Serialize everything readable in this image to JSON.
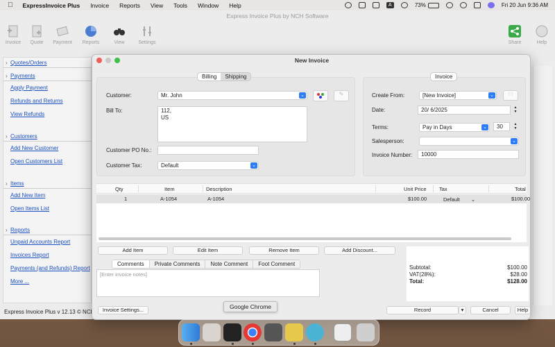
{
  "menubar": {
    "app_name": "ExpressInvoice Plus",
    "menus": [
      "Invoice",
      "Reports",
      "View",
      "Tools",
      "Window",
      "Help"
    ],
    "battery": "73%",
    "clock": "Fri 20 Jun  9:36 AM",
    "input_letter": "A"
  },
  "window": {
    "title": "Express Invoice Plus by NCH Software",
    "status": "Express Invoice Plus v 12.13 © NCH"
  },
  "toolbar": {
    "invoice": "Invoice",
    "quote": "Quote",
    "payment": "Payment",
    "reports": "Reports",
    "view": "View",
    "settings": "Settings",
    "share": "Share",
    "help": "Help"
  },
  "sidebar": {
    "quotes_head": "Quotes/Orders",
    "payments_head": "Payments",
    "payments_links": [
      "Apply Payment",
      "Refunds and Returns",
      "View Refunds"
    ],
    "customers_head": "Customers",
    "customers_links": [
      "Add New Customer",
      "Open Customers List"
    ],
    "items_head": "Items",
    "items_links": [
      "Add New Item",
      "Open Items List"
    ],
    "reports_head": "Reports",
    "reports_links": [
      "Unpaid Accounts Report",
      "Invoices Report",
      "Payments (and Refunds) Report",
      "More ..."
    ]
  },
  "dialog": {
    "title": "New Invoice",
    "tab_billing": "Billing",
    "tab_shipping": "Shipping",
    "customer_label": "Customer:",
    "customer_value": "Mr. John",
    "bill_to_label": "Bill To:",
    "bill_to_line1": "112,",
    "bill_to_line2": "US",
    "po_label": "Customer PO No.:",
    "po_value": "",
    "tax_label": "Customer Tax:",
    "tax_value": "Default",
    "invoice_tab": "Invoice",
    "create_from_label": "Create From:",
    "create_from_value": "[New Invoice]",
    "date_label": "Date:",
    "date_value": "20/  6/2025",
    "terms_label": "Terms:",
    "terms_value": "Pay in Days",
    "terms_days": "30",
    "salesperson_label": "Salesperson:",
    "salesperson_value": "",
    "invoice_number_label": "Invoice Number:",
    "invoice_number_value": "10000"
  },
  "items_table": {
    "headers": [
      "Qty",
      "Item",
      "Description",
      "Unit Price",
      "Tax",
      "Total"
    ],
    "rows": [
      {
        "qty": "1",
        "item": "A-1054",
        "description": "A-1054",
        "unit_price": "$100.00",
        "tax": "Default",
        "total": "$100.00"
      }
    ]
  },
  "actions": {
    "add_item": "Add Item",
    "edit_item": "Edit Item",
    "remove_item": "Remove Item",
    "add_discount": "Add Discount..."
  },
  "note_tabs": [
    "Comments",
    "Private Comments",
    "Note Comment",
    "Foot Comment"
  ],
  "notes_placeholder": "[Enter invoice notes]",
  "totals": {
    "subtotal_label": "Subtotal:",
    "subtotal_value": "$100.00",
    "vat_label": "VAT(28%):",
    "vat_value": "$28.00",
    "total_label": "Total:",
    "total_value": "$128.00"
  },
  "footer": {
    "invoice_settings": "Invoice Settings...",
    "record": "Record",
    "cancel": "Cancel",
    "help": "Help"
  },
  "tooltip": "Google Chrome",
  "colors": {
    "accent": "#2e7cf6",
    "link": "#1a4fbf",
    "selected_row": "#e2e2e2"
  }
}
